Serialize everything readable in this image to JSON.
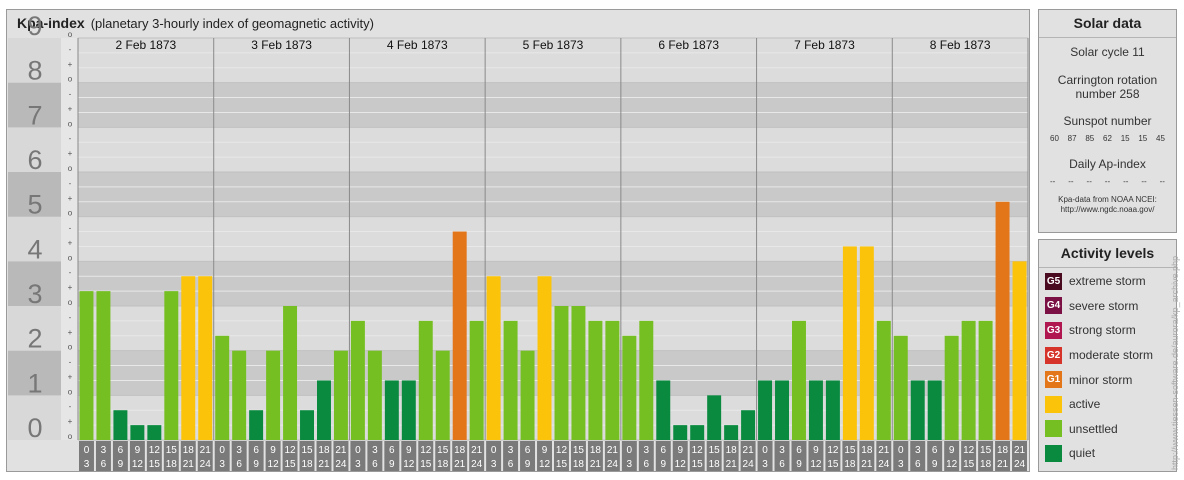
{
  "header": {
    "title": "Kpa-index",
    "subtitle": "(planetary 3-hourly index of geomagnetic activity)"
  },
  "chart_data": {
    "type": "bar",
    "title": "Kpa-index",
    "subtitle": "(planetary 3-hourly index of geomagnetic activity)",
    "ylim": [
      0,
      9
    ],
    "y_ticks": [
      "0",
      "1",
      "2",
      "3",
      "4",
      "5",
      "6",
      "7",
      "8",
      "9"
    ],
    "minor_ticks": [
      "o",
      "+",
      "-"
    ],
    "days": [
      "2 Feb 1873",
      "3 Feb 1873",
      "4 Feb 1873",
      "5 Feb 1873",
      "6 Feb 1873",
      "7 Feb 1873",
      "8 Feb 1873"
    ],
    "intervals": [
      [
        "0",
        "3"
      ],
      [
        "3",
        "6"
      ],
      [
        "6",
        "9"
      ],
      [
        "9",
        "12"
      ],
      [
        "12",
        "15"
      ],
      [
        "15",
        "18"
      ],
      [
        "18",
        "21"
      ],
      [
        "21",
        "24"
      ]
    ],
    "values": [
      [
        3.333,
        3.333,
        0.667,
        0.333,
        0.333,
        3.333,
        3.667,
        3.667
      ],
      [
        2.333,
        2.0,
        0.667,
        2.0,
        3.0,
        0.667,
        1.333,
        2.0
      ],
      [
        2.667,
        2.0,
        1.333,
        1.333,
        2.667,
        2.0,
        4.667,
        2.667
      ],
      [
        3.667,
        2.667,
        2.0,
        3.667,
        3.0,
        3.0,
        2.667,
        2.667
      ],
      [
        2.333,
        2.667,
        1.333,
        0.333,
        0.333,
        1.0,
        0.333,
        0.667
      ],
      [
        1.333,
        1.333,
        2.667,
        1.333,
        1.333,
        4.333,
        4.333,
        2.667
      ],
      [
        2.333,
        1.333,
        1.333,
        2.333,
        2.667,
        2.667,
        5.333,
        4.0
      ]
    ],
    "colors": {
      "quiet": "#0a8a3f",
      "unsettled": "#76bf23",
      "active": "#fbc30a",
      "G1": "#e4761a"
    },
    "grid": true
  },
  "solar": {
    "title": "Solar data",
    "cycle": "Solar cycle 11",
    "carrington_1": "Carrington rotation",
    "carrington_2": "number 258",
    "sunspot_label": "Sunspot number",
    "sunspot_values": [
      "60",
      "87",
      "85",
      "62",
      "15",
      "15",
      "45"
    ],
    "ap_label": "Daily Ap-index",
    "ap_values": [
      "--",
      "--",
      "--",
      "--",
      "--",
      "--",
      "--"
    ],
    "source_1": "Kpa-data from NOAA NCEI:",
    "source_2": "http://www.ngdc.noaa.gov/"
  },
  "activity": {
    "title": "Activity levels",
    "items": [
      {
        "code": "G5",
        "label": "extreme storm",
        "color": "#4a0a20"
      },
      {
        "code": "G4",
        "label": "severe storm",
        "color": "#7a1043"
      },
      {
        "code": "G3",
        "label": "strong storm",
        "color": "#b0164f"
      },
      {
        "code": "G2",
        "label": "moderate storm",
        "color": "#d6342a"
      },
      {
        "code": "G1",
        "label": "minor storm",
        "color": "#e4761a"
      },
      {
        "code": "",
        "label": "active",
        "color": "#fbc30a"
      },
      {
        "code": "",
        "label": "unsettled",
        "color": "#76bf23"
      },
      {
        "code": "",
        "label": "quiet",
        "color": "#0a8a3f"
      }
    ]
  },
  "watermark": "http://www.tiessen-software.de/aurora/kp_archive.php"
}
